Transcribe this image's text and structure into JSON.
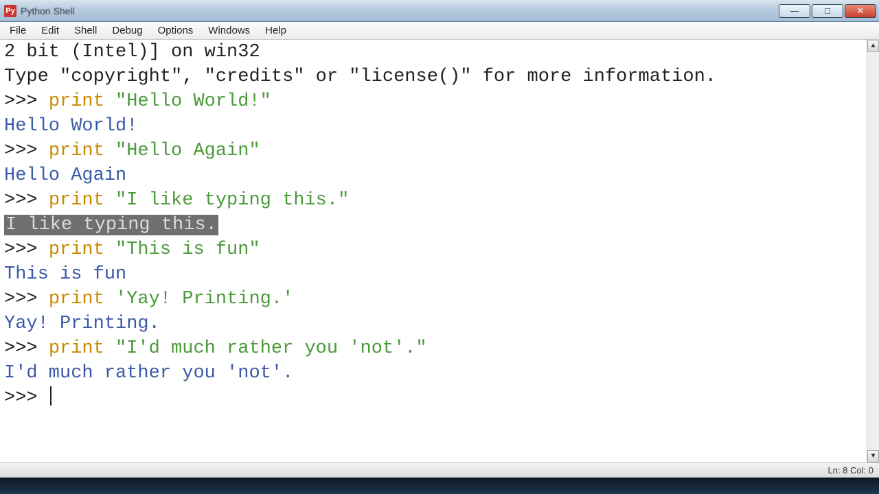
{
  "window": {
    "title": "Python Shell",
    "icon_label": "Py"
  },
  "menubar": {
    "items": [
      "File",
      "Edit",
      "Shell",
      "Debug",
      "Options",
      "Windows",
      "Help"
    ]
  },
  "colors": {
    "keyword": "#c98a00",
    "string": "#4a9a3a",
    "output": "#3a5aa8"
  },
  "shell": {
    "info_line1": "2 bit (Intel)] on win32",
    "info_line2": "Type \"copyright\", \"credits\" or \"license()\" for more information.",
    "prompt": ">>> ",
    "interactions": [
      {
        "cmd_keyword": "print",
        "cmd_rest": " \"Hello World!\"",
        "output": "Hello World!"
      },
      {
        "cmd_keyword": "print",
        "cmd_rest": " \"Hello Again\"",
        "output": "Hello Again"
      },
      {
        "cmd_keyword": "print",
        "cmd_rest": " \"I like typing this.\"",
        "output": "I like typing this.",
        "output_selected": true
      },
      {
        "cmd_keyword": "print",
        "cmd_rest": " \"This is fun\"",
        "output": "This is fun"
      },
      {
        "cmd_keyword": "print",
        "cmd_rest": " 'Yay! Printing.'",
        "output": "Yay! Printing."
      },
      {
        "cmd_keyword": "print",
        "cmd_rest": " \"I'd much rather you 'not'.\"",
        "output": "I'd much rather you 'not'."
      }
    ]
  },
  "statusbar": {
    "text": "Ln: 8  Col: 0"
  }
}
